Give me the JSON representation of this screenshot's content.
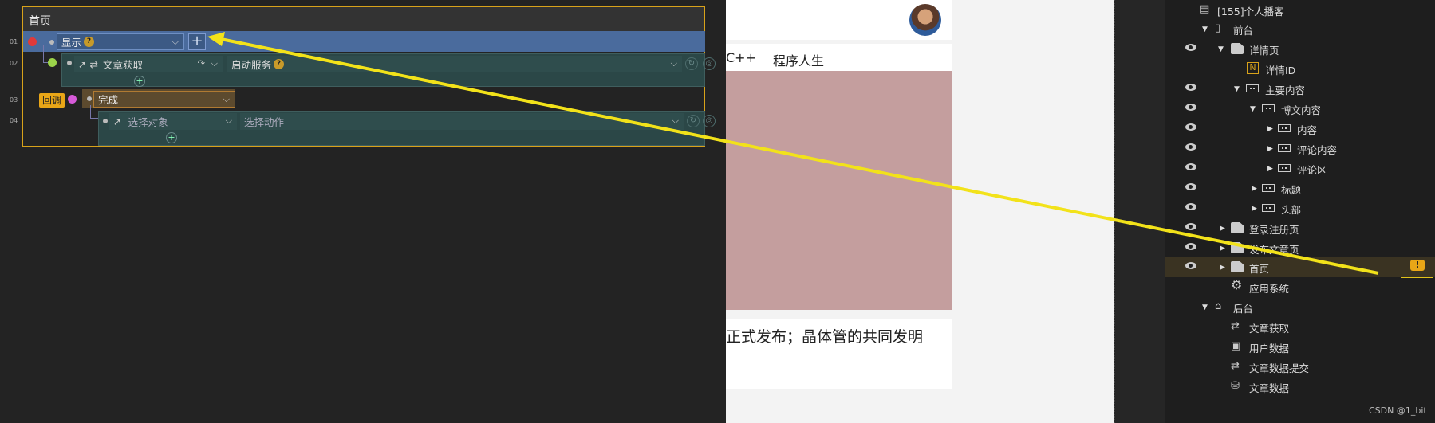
{
  "editor": {
    "panel_title": "首页",
    "line_numbers": [
      "01",
      "02",
      "03",
      "04"
    ],
    "rows": {
      "display_label": "显示",
      "add_symbol": "+",
      "fetch_label": "文章获取",
      "service_label": "启动服务",
      "callback_badge": "回调",
      "done_label": "完成",
      "target_placeholder": "选择对象",
      "action_placeholder": "选择动作"
    },
    "help_symbol": "?",
    "chevron": "⌵"
  },
  "preview": {
    "nav_left": "C++",
    "nav_right": "程序人生",
    "headline_fragment": "正式发布；晶体管的共同发明"
  },
  "tree": {
    "items": [
      {
        "label": "[155]个人播客",
        "icon": "app-icon"
      },
      {
        "label": "前台",
        "icon": "phone-icon"
      },
      {
        "label": "详情页",
        "icon": "page-icon"
      },
      {
        "label": "详情ID",
        "icon": "n-param-icon"
      },
      {
        "label": "主要内容",
        "icon": "container-icon"
      },
      {
        "label": "博文内容",
        "icon": "container-icon"
      },
      {
        "label": "内容",
        "icon": "container-icon"
      },
      {
        "label": "评论内容",
        "icon": "container-icon"
      },
      {
        "label": "评论区",
        "icon": "container-icon"
      },
      {
        "label": "标题",
        "icon": "container-icon"
      },
      {
        "label": "头部",
        "icon": "container-icon"
      },
      {
        "label": "登录注册页",
        "icon": "page-icon"
      },
      {
        "label": "发布文章页",
        "icon": "page-icon"
      },
      {
        "label": "首页",
        "icon": "page-icon"
      },
      {
        "label": "应用系统",
        "icon": "gear-icon"
      },
      {
        "label": "后台",
        "icon": "home-icon"
      },
      {
        "label": "文章获取",
        "icon": "transfer-icon"
      },
      {
        "label": "用户数据",
        "icon": "user-icon"
      },
      {
        "label": "文章数据提交",
        "icon": "transfer-icon"
      },
      {
        "label": "文章数据",
        "icon": "database-icon"
      }
    ],
    "warning_symbol": "!",
    "watermark": "CSDN @1_bit"
  },
  "colors": {
    "panel_border": "#d8a21a",
    "row_blue": "#4a6b9d",
    "row_teal": "#2b4747",
    "arrow": "#f2e21a",
    "preview_image": "#c49e9e"
  }
}
